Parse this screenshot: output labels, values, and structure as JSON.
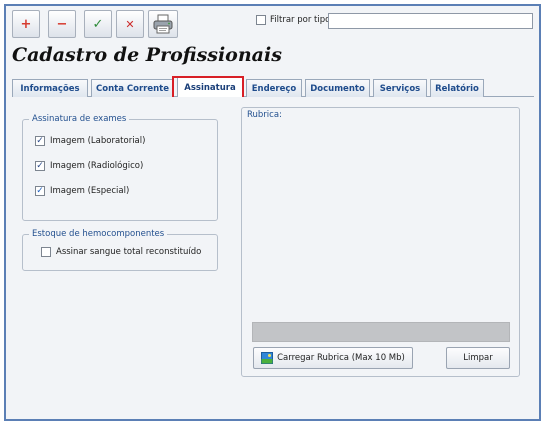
{
  "toolbar": {
    "add_symbol": "+",
    "remove_symbol": "−",
    "confirm_symbol": "✓",
    "cancel_symbol": "✕",
    "print_icon": "printer-icon"
  },
  "filter": {
    "label": "Filtrar por tipo:",
    "checked": false,
    "value": ""
  },
  "page": {
    "title": "Cadastro de Profissionais"
  },
  "tabs": [
    {
      "label": "Informações"
    },
    {
      "label": "Conta Corrente"
    },
    {
      "label": "Assinatura"
    },
    {
      "label": "Endereço"
    },
    {
      "label": "Documento"
    },
    {
      "label": "Serviços"
    },
    {
      "label": "Relatório"
    }
  ],
  "active_tab": "Assinatura",
  "exam_signature": {
    "legend": "Assinatura de exames",
    "items": [
      {
        "label": "Imagem (Laboratorial)",
        "checked": true
      },
      {
        "label": "Imagem (Radiológico)",
        "checked": true
      },
      {
        "label": "Imagem (Especial)",
        "checked": true
      }
    ]
  },
  "blood_stock": {
    "legend": "Estoque de hemocomponentes",
    "items": [
      {
        "label": "Assinar sangue total reconstituído",
        "checked": false
      }
    ]
  },
  "rubrica": {
    "label": "Rubrica:",
    "load_button": "Carregar Rubrica (Max 10 Mb)",
    "clear_button": "Limpar"
  },
  "colors": {
    "window_border": "#5b7fb5",
    "tab_text": "#1f4c8c",
    "highlight": "#d81f26",
    "add": "#d63b2f",
    "remove": "#d63b2f",
    "confirm": "#2e8b3a",
    "cancel": "#cc2b2b"
  }
}
